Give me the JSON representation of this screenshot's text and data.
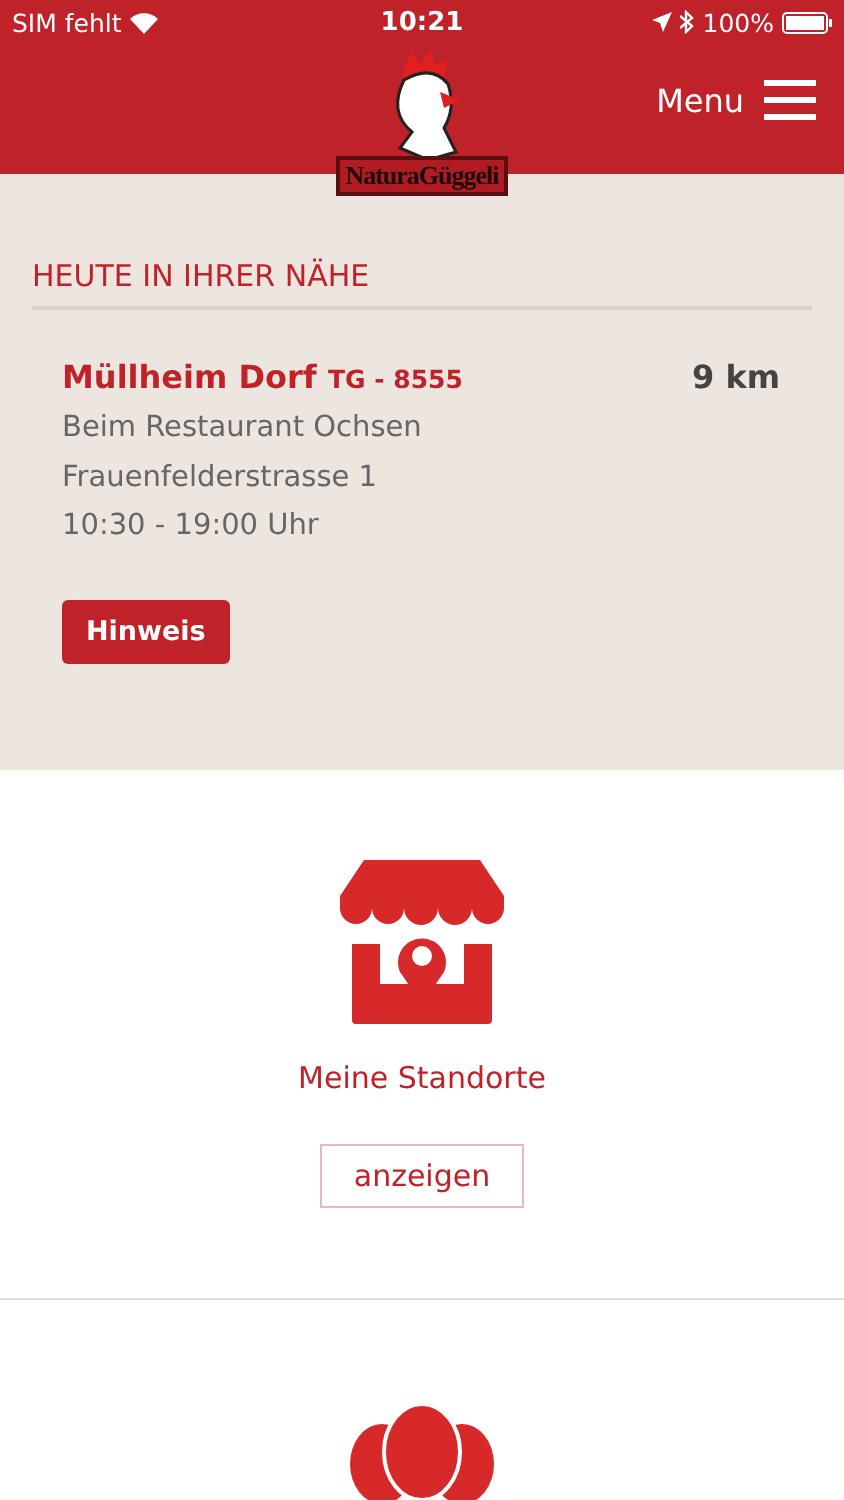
{
  "status_bar": {
    "carrier": "SIM fehlt",
    "time": "10:21",
    "battery": "100%"
  },
  "header": {
    "logo_text": "NaturaGüggeli",
    "menu_label": "Menu"
  },
  "nearby": {
    "heading": "HEUTE IN IHRER NÄHE",
    "place": "Müllheim Dorf",
    "region": "TG - 8555",
    "distance": "9 km",
    "lines": [
      "Beim Restaurant Ochsen",
      "Frauenfelderstrasse 1",
      "10:30 - 19:00 Uhr"
    ],
    "button": "Hinweis"
  },
  "locations": {
    "title": "Meine Standorte",
    "button": "anzeigen"
  }
}
